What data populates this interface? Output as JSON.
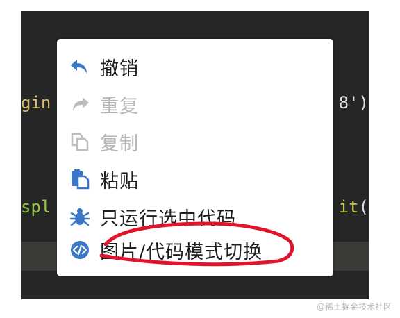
{
  "code": {
    "left_line_1": "gin",
    "right_line_1": "8')",
    "left_line_2": "spl",
    "right_line_2_text": "it",
    "right_line_2_paren": "("
  },
  "context_menu": {
    "items": [
      {
        "label": "撤销",
        "icon": "undo-icon",
        "enabled": true
      },
      {
        "label": "重复",
        "icon": "redo-icon",
        "enabled": false
      },
      {
        "label": "复制",
        "icon": "copy-icon",
        "enabled": false
      },
      {
        "label": "粘贴",
        "icon": "paste-icon",
        "enabled": true
      },
      {
        "label": "只运行选中代码",
        "icon": "bug-icon",
        "enabled": true
      },
      {
        "label": "图片/代码模式切换",
        "icon": "code-toggle-icon",
        "enabled": true
      }
    ]
  },
  "watermark": "@稀土掘金技术社区",
  "colors": {
    "editor_background": "#262626",
    "icon_blue": "#3d78c8",
    "disabled_gray": "#b5b5b5",
    "annotation_red": "#e0142a"
  }
}
